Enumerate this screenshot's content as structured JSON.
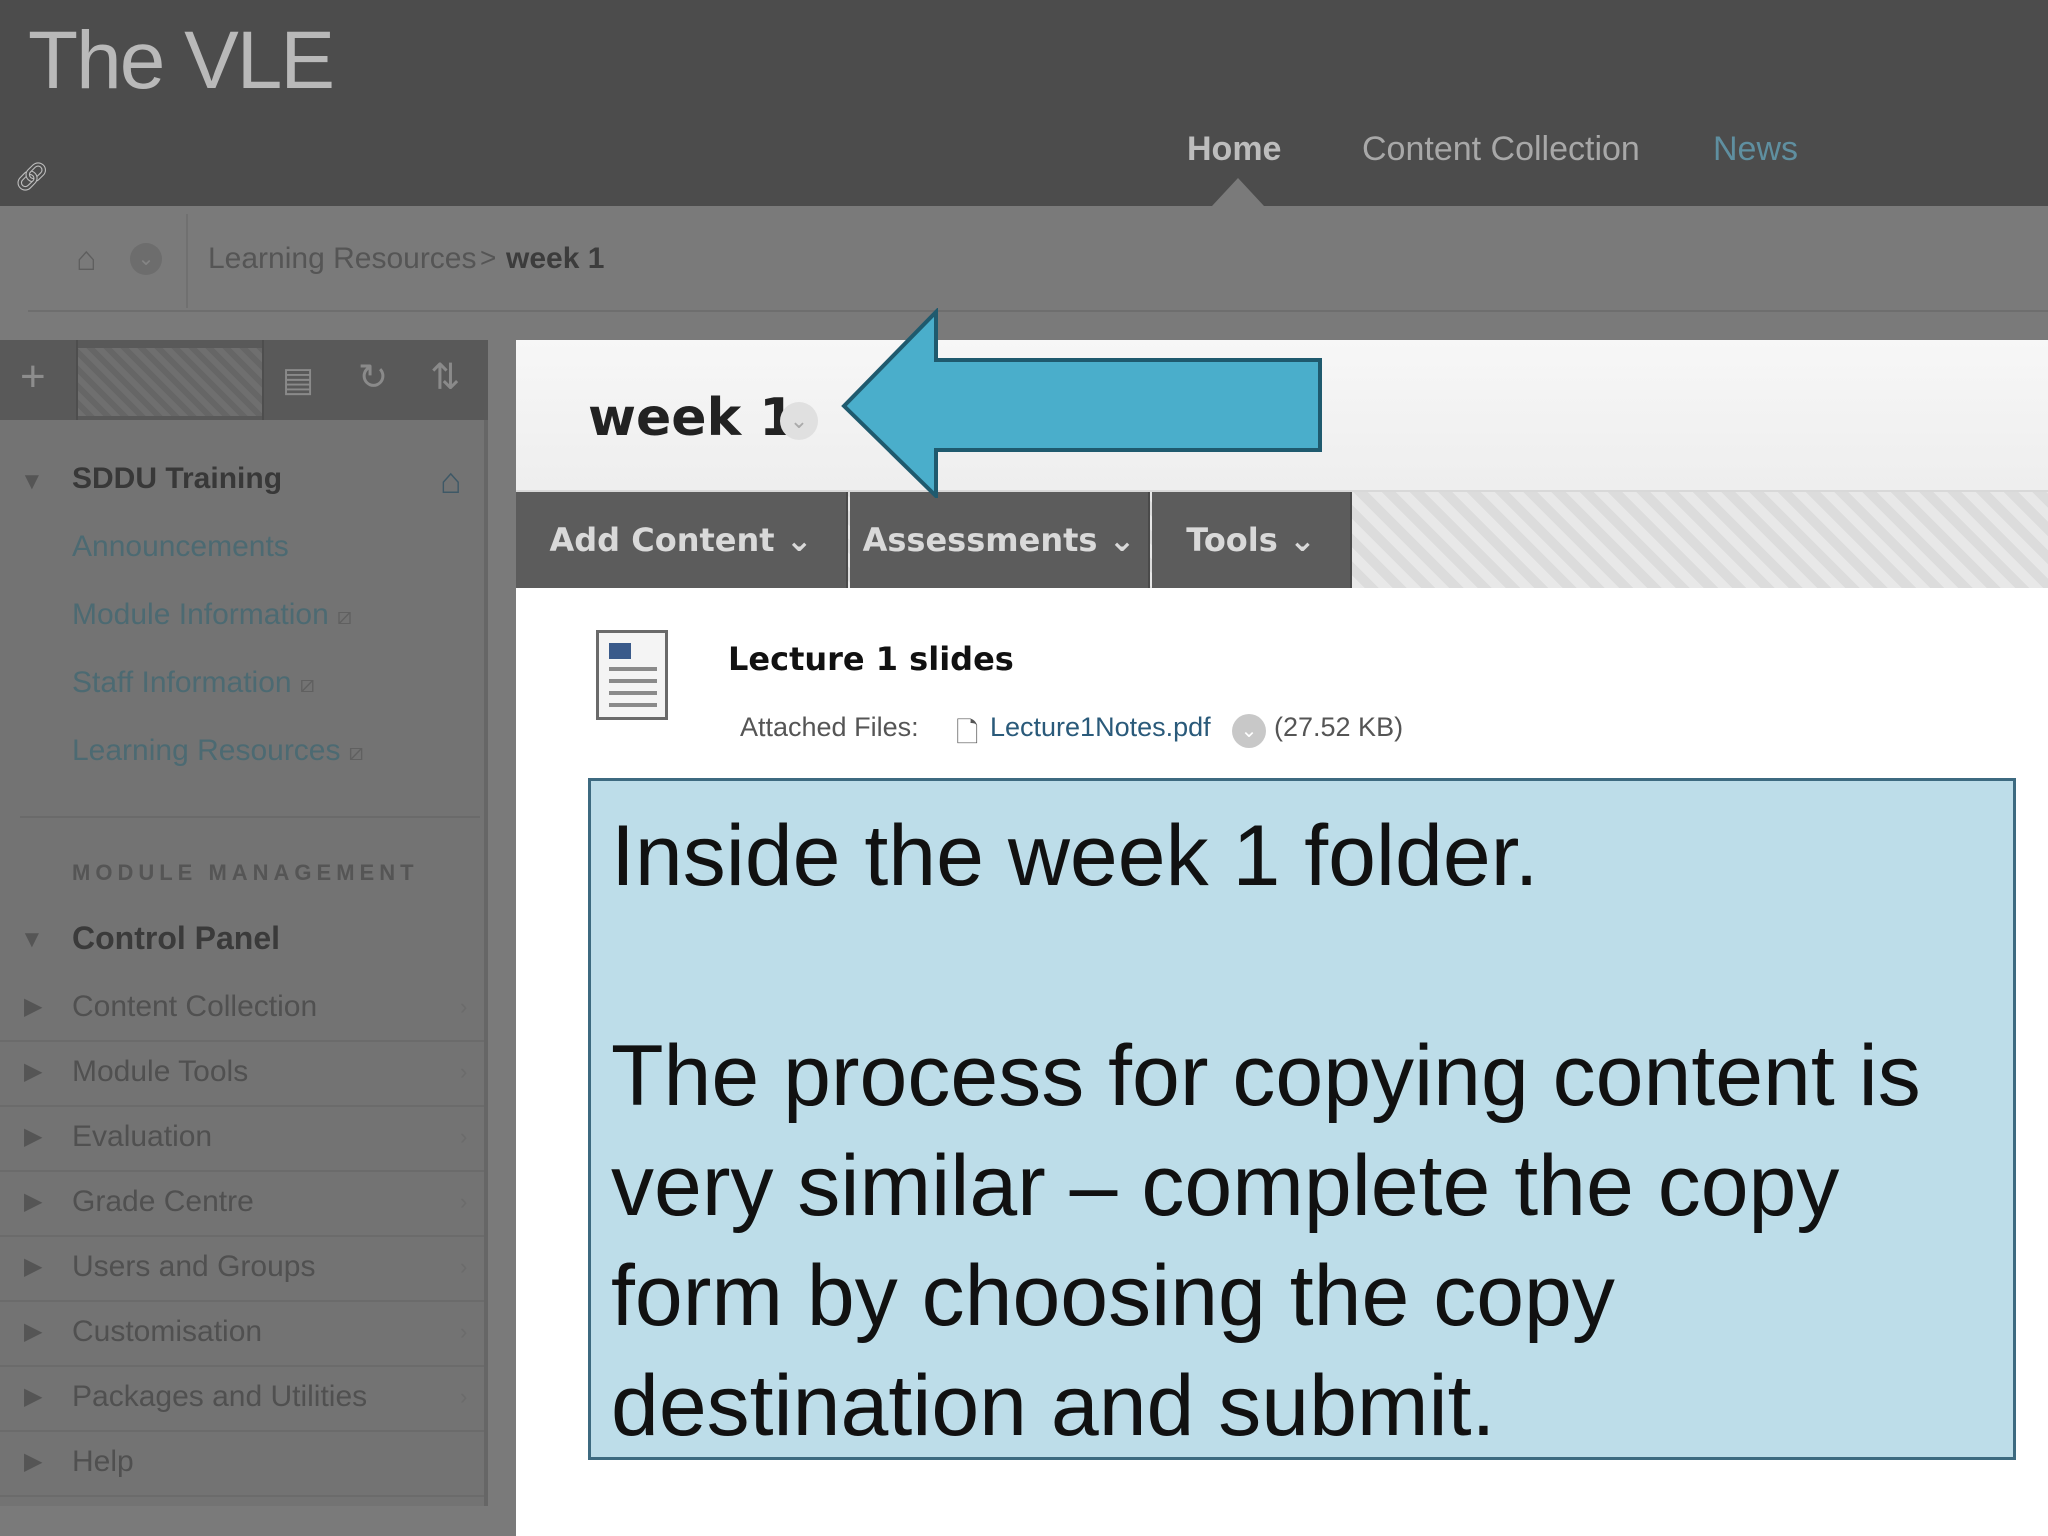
{
  "header": {
    "brand": "The VLE",
    "nav": {
      "home": "Home",
      "content_collection": "Content Collection",
      "news": "News"
    }
  },
  "breadcrumb": {
    "items": [
      "Learning Resources",
      "week 1"
    ],
    "separator": ">"
  },
  "sidebar": {
    "course_title": "SDDU Training",
    "links": [
      {
        "label": "Announcements",
        "external": false
      },
      {
        "label": "Module Information",
        "external": true
      },
      {
        "label": "Staff Information",
        "external": true
      },
      {
        "label": "Learning Resources",
        "external": true
      }
    ],
    "management_heading": "MODULE MANAGEMENT",
    "control_panel": "Control Panel",
    "tools": [
      "Content Collection",
      "Module Tools",
      "Evaluation",
      "Grade Centre",
      "Users and Groups",
      "Customisation",
      "Packages and Utilities",
      "Help"
    ]
  },
  "content": {
    "title": "week 1",
    "actions": {
      "add_content": "Add Content",
      "assessments": "Assessments",
      "tools": "Tools"
    },
    "item": {
      "title": "Lecture 1 slides",
      "attached_label": "Attached Files:",
      "file_name": "Lecture1Notes.pdf",
      "file_size": "(27.52 KB)"
    }
  },
  "note": {
    "line1": "Inside the week 1 folder.",
    "line2": "The process for copying content is very similar – complete the copy form by choosing the copy destination and submit."
  },
  "colors": {
    "arrow_fill": "#4aaecb",
    "note_bg": "#bddde9",
    "header_bg": "#4c4c4c"
  }
}
